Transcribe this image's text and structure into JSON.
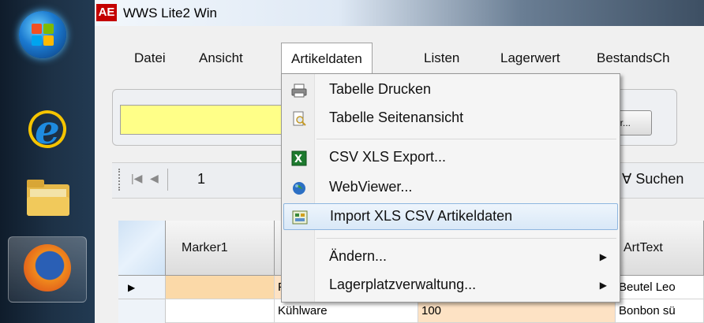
{
  "window": {
    "app_badge": "AE",
    "title": "WWS Lite2 Win"
  },
  "menubar": [
    {
      "label": "Datei"
    },
    {
      "label": "Ansicht"
    },
    {
      "label": "Artikeldaten"
    },
    {
      "label": "Listen"
    },
    {
      "label": "Lagerwert"
    },
    {
      "label": "BestandsCh"
    }
  ],
  "filter": {
    "more_button": "hr..."
  },
  "navigator": {
    "first_icon": "first-record-icon",
    "prev_icon": "prev-record-icon",
    "page": "1",
    "search_label": "∀ Suchen"
  },
  "grid": {
    "columns": [
      {
        "label": "Marker1"
      },
      {
        "label": ""
      },
      {
        "label": ""
      },
      {
        "label": "ArtText"
      }
    ],
    "rows": [
      {
        "marker": "",
        "c2": "F",
        "c3": "",
        "arttext": "Beutel Leo"
      },
      {
        "marker": "",
        "c2": "Kühlware",
        "c3": "100",
        "arttext": "Bonbon sü"
      }
    ]
  },
  "dropdown": {
    "items": [
      {
        "label": "Tabelle Drucken",
        "icon": "printer-icon"
      },
      {
        "label": "Tabelle Seitenansicht",
        "icon": "print-preview-icon"
      },
      {
        "label": "CSV XLS Export...",
        "icon": "excel-export-icon"
      },
      {
        "label": "WebViewer...",
        "icon": "globe-icon"
      },
      {
        "label": "Import XLS CSV Artikeldaten",
        "icon": "import-table-icon"
      },
      {
        "label": "Ändern...",
        "icon": ""
      },
      {
        "label": "Lagerplatzverwaltung...",
        "icon": ""
      }
    ]
  },
  "taskbar": {
    "items": [
      {
        "icon": "windows-start-icon"
      },
      {
        "icon": "internet-explorer-icon"
      },
      {
        "icon": "explorer-folder-icon"
      },
      {
        "icon": "firefox-icon"
      }
    ]
  }
}
